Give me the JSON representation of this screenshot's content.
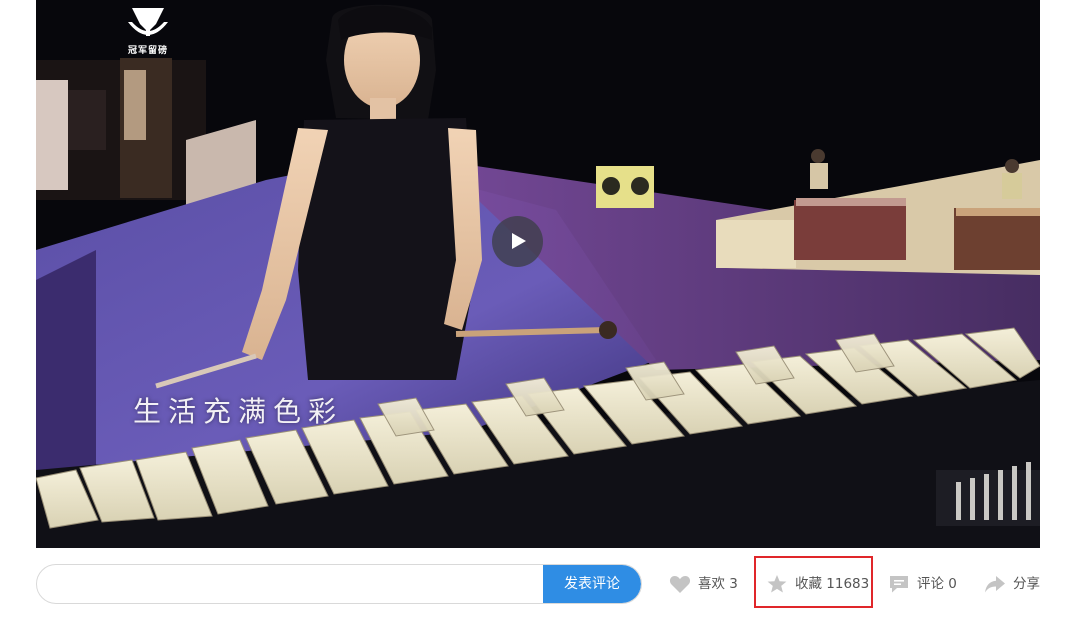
{
  "video": {
    "logo_text": "冠军留磅",
    "subtitle": "生活充满色彩",
    "play_icon": "play-icon"
  },
  "comment": {
    "placeholder": "",
    "submit_label": "发表评论"
  },
  "actions": {
    "like": {
      "icon": "heart-icon",
      "label": "喜欢 3"
    },
    "favorite": {
      "icon": "star-icon",
      "label": "收藏 11683"
    },
    "comments": {
      "icon": "comment-icon",
      "label": "评论 0"
    },
    "share": {
      "icon": "share-icon",
      "label": "分享"
    }
  },
  "colors": {
    "accent": "#2f8de4",
    "highlight": "#e0262a",
    "icon_gray": "#c4c4c4",
    "text_gray": "#555555"
  }
}
